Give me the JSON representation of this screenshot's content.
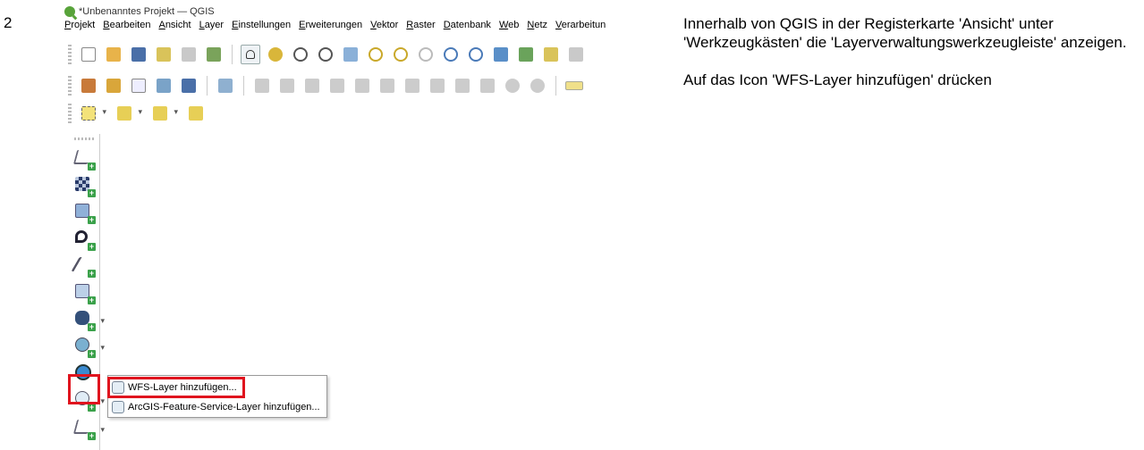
{
  "step_number": "2",
  "window": {
    "title": "*Unbenanntes Projekt — QGIS"
  },
  "menubar": [
    "Projekt",
    "Bearbeiten",
    "Ansicht",
    "Layer",
    "Einstellungen",
    "Erweiterungen",
    "Vektor",
    "Raster",
    "Datenbank",
    "Web",
    "Netz",
    "Verarbeitun"
  ],
  "colors": {
    "highlight": "#e0141e",
    "plus_badge": "#3aa14a"
  },
  "left_toolbar_icons": [
    "add-vector-layer-icon",
    "add-raster-layer-icon",
    "add-mesh-layer-icon",
    "add-delimited-text-icon",
    "add-gps-icon",
    "add-virtual-layer-icon",
    "add-postgis-icon",
    "add-wms-icon",
    "add-xyz-icon",
    "add-wfs-icon",
    "add-vector-layer-2-icon"
  ],
  "dropdown": {
    "items": [
      {
        "label": "WFS-Layer hinzufügen...",
        "icon": "wfs-icon"
      },
      {
        "label": "ArcGIS-Feature-Service-Layer hinzufügen...",
        "icon": "arcgis-icon"
      }
    ]
  },
  "instructions": {
    "paragraph1": "Innerhalb von QGIS in der Registerkarte 'Ansicht' unter 'Werkzeugkästen' die 'Layerverwaltungswerkzeugleiste' anzeigen.",
    "paragraph2": "Auf das Icon 'WFS-Layer hinzufügen' drücken"
  }
}
